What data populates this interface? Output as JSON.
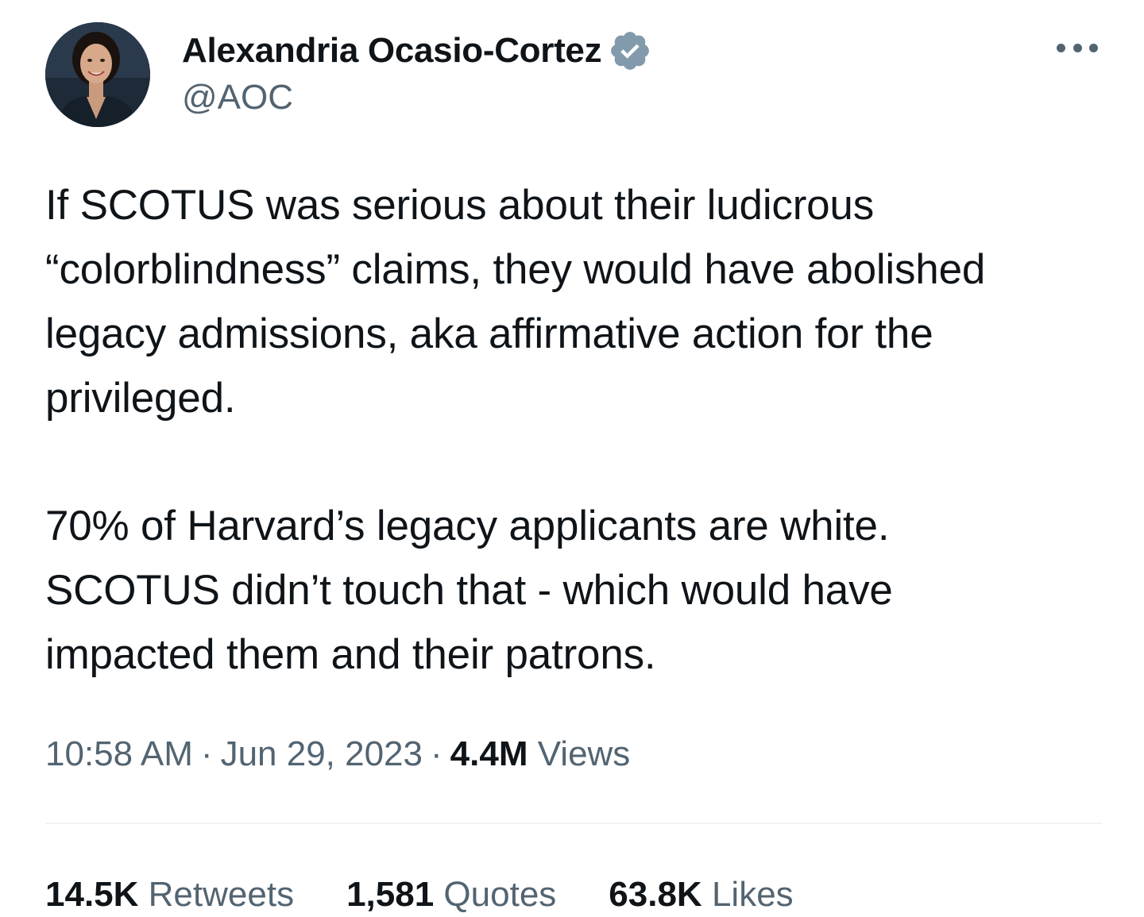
{
  "user": {
    "display_name": "Alexandria Ocasio-Cortez",
    "handle": "@AOC",
    "avatar_icon": "profile-photo",
    "verified_icon": "verified-badge-icon",
    "verified_color": "#829aab"
  },
  "menu": {
    "icon": "more-options-icon"
  },
  "tweet": {
    "paragraph_1": "If SCOTUS was serious about their ludicrous\n“colorblindness” claims, they would have abolished\nlegacy admissions, aka affirmative action for the\nprivileged.",
    "paragraph_2": "70% of Harvard’s legacy applicants are white.\nSCOTUS didn’t touch that - which would have\nimpacted them and their patrons."
  },
  "meta": {
    "time": "10:58 AM",
    "separator": "·",
    "date": "Jun 29, 2023",
    "views_count": "4.4M",
    "views_label": "Views"
  },
  "stats": {
    "retweets_count": "14.5K",
    "retweets_label": "Retweets",
    "quotes_count": "1,581",
    "quotes_label": "Quotes",
    "likes_count": "63.8K",
    "likes_label": "Likes"
  },
  "colors": {
    "text_primary": "#0f1419",
    "text_secondary": "#536471",
    "divider": "#eff3f4"
  }
}
